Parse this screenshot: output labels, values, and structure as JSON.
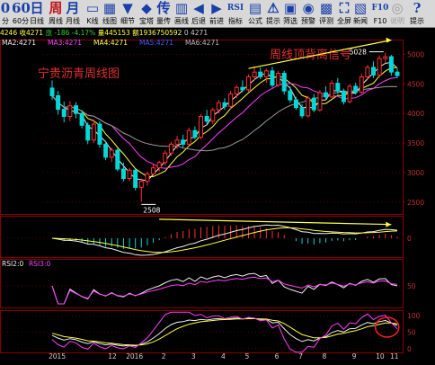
{
  "toolbar": {
    "items": [
      {
        "glyph": "0",
        "label": "分",
        "color": "blue"
      },
      {
        "glyph": "60",
        "label": "60分",
        "color": "blue"
      },
      {
        "glyph": "日",
        "label": "日线",
        "color": "blue"
      },
      {
        "glyph": "周",
        "label": "周线",
        "color": "red"
      },
      {
        "glyph": "月",
        "label": "月线",
        "color": "blue"
      },
      {
        "glyph": "▭",
        "label": "K线",
        "color": "blue"
      },
      {
        "glyph": "▦",
        "label": "线图",
        "color": "blue"
      },
      {
        "glyph": "▼",
        "label": "细节",
        "color": "blue"
      },
      {
        "glyph": "◆",
        "label": "宝塔",
        "color": "blue"
      },
      {
        "glyph": "传",
        "label": "量传",
        "color": "blue"
      },
      {
        "glyph": "▥",
        "label": "画线",
        "color": "blue"
      },
      {
        "glyph": "◀",
        "label": "后退",
        "color": "blue"
      },
      {
        "glyph": "▶",
        "label": "前进",
        "color": "blue"
      },
      {
        "glyph": "RSI",
        "label": "指标",
        "color": "blue"
      },
      {
        "glyph": "▤",
        "label": "公式",
        "color": "blue"
      },
      {
        "glyph": "⚠",
        "label": "提示",
        "color": "blue"
      },
      {
        "glyph": "▣",
        "label": "筛选",
        "color": "blue"
      },
      {
        "glyph": "◉",
        "label": "预警",
        "color": "blue"
      },
      {
        "glyph": "▩",
        "label": "评测",
        "color": "blue"
      },
      {
        "glyph": "⛶",
        "label": "全屏",
        "color": "blue"
      },
      {
        "glyph": "▧",
        "label": "新闻",
        "color": "blue"
      },
      {
        "glyph": "F10",
        "label": "F10",
        "color": "blue"
      },
      {
        "glyph": "◎",
        "label": "说明",
        "color": "dim"
      },
      {
        "glyph": "?",
        "label": "提示",
        "color": "blue"
      }
    ]
  },
  "infobar": {
    "a": "4246",
    "b": "收4271",
    "c": "涨 -186",
    "d": "-4.17%",
    "e": "量445153",
    "f": "额1936750592",
    "g": "0",
    "h": "4271"
  },
  "chart_data": {
    "type": "candlestick",
    "annotations": {
      "stock_name": "宁贵沥青周线图",
      "signal_label": "周线顶背离信号",
      "high_label": "5028",
      "low_label": "2508"
    },
    "ma_legend": [
      {
        "text": "MA2:4271",
        "color": "#f0f0f0"
      },
      {
        "text": "MA3:4271",
        "color": "#ff40ff"
      },
      {
        "text": "MA4:4271",
        "color": "#ffff40"
      },
      {
        "text": "MA5:4271",
        "color": "#4060ff"
      },
      {
        "text": "MA6:4271",
        "color": "#bbbbbb"
      }
    ],
    "rsi_legend": [
      {
        "text": "RSI2:0",
        "color": "#f0f0f0"
      },
      {
        "text": "RSI3:0",
        "color": "#ff40ff"
      }
    ],
    "y_ticks": [
      5000,
      4500,
      4000,
      3500,
      3000,
      2500
    ],
    "ylim": [
      2300,
      5250
    ],
    "macd_ticks": [
      0
    ],
    "rsi_ticks": [
      50
    ],
    "kdj_ticks": [
      100,
      50,
      0
    ],
    "x_ticks": [
      "2015",
      "12",
      "2016",
      "2",
      "3",
      "4",
      "5",
      "6",
      "7",
      "8",
      "9",
      "10",
      "11"
    ],
    "candles": [
      {
        "o": 4430,
        "h": 4560,
        "l": 4230,
        "c": 4300
      },
      {
        "o": 4300,
        "h": 4380,
        "l": 3980,
        "c": 4070
      },
      {
        "o": 4070,
        "h": 4200,
        "l": 3850,
        "c": 3950
      },
      {
        "o": 3950,
        "h": 4210,
        "l": 3870,
        "c": 4130
      },
      {
        "o": 4130,
        "h": 4190,
        "l": 3920,
        "c": 4000
      },
      {
        "o": 4000,
        "h": 4060,
        "l": 3750,
        "c": 3800
      },
      {
        "o": 3800,
        "h": 3850,
        "l": 3480,
        "c": 3550
      },
      {
        "o": 3550,
        "h": 3900,
        "l": 3500,
        "c": 3820
      },
      {
        "o": 3820,
        "h": 3870,
        "l": 3420,
        "c": 3480
      },
      {
        "o": 3480,
        "h": 3540,
        "l": 3210,
        "c": 3260
      },
      {
        "o": 3260,
        "h": 3420,
        "l": 3180,
        "c": 3380
      },
      {
        "o": 3380,
        "h": 3410,
        "l": 3020,
        "c": 3060
      },
      {
        "o": 3060,
        "h": 3170,
        "l": 2850,
        "c": 2900
      },
      {
        "o": 2900,
        "h": 3080,
        "l": 2850,
        "c": 3040
      },
      {
        "o": 3040,
        "h": 3060,
        "l": 2700,
        "c": 2750
      },
      {
        "o": 2750,
        "h": 2900,
        "l": 2508,
        "c": 2850
      },
      {
        "o": 2850,
        "h": 3020,
        "l": 2780,
        "c": 2980
      },
      {
        "o": 2980,
        "h": 3150,
        "l": 2940,
        "c": 3080
      },
      {
        "o": 3080,
        "h": 3200,
        "l": 3020,
        "c": 3170
      },
      {
        "o": 3170,
        "h": 3380,
        "l": 3120,
        "c": 3330
      },
      {
        "o": 3330,
        "h": 3520,
        "l": 3280,
        "c": 3480
      },
      {
        "o": 3480,
        "h": 3620,
        "l": 3400,
        "c": 3550
      },
      {
        "o": 3550,
        "h": 3640,
        "l": 3420,
        "c": 3480
      },
      {
        "o": 3480,
        "h": 3760,
        "l": 3450,
        "c": 3710
      },
      {
        "o": 3710,
        "h": 3780,
        "l": 3560,
        "c": 3600
      },
      {
        "o": 3600,
        "h": 3990,
        "l": 3560,
        "c": 3950
      },
      {
        "o": 3950,
        "h": 4060,
        "l": 3820,
        "c": 3870
      },
      {
        "o": 3870,
        "h": 4100,
        "l": 3820,
        "c": 4060
      },
      {
        "o": 4060,
        "h": 4230,
        "l": 4000,
        "c": 4180
      },
      {
        "o": 4180,
        "h": 4260,
        "l": 4060,
        "c": 4120
      },
      {
        "o": 4120,
        "h": 4380,
        "l": 4080,
        "c": 4330
      },
      {
        "o": 4330,
        "h": 4480,
        "l": 4260,
        "c": 4440
      },
      {
        "o": 4440,
        "h": 4560,
        "l": 4360,
        "c": 4400
      },
      {
        "o": 4400,
        "h": 4660,
        "l": 4370,
        "c": 4620
      },
      {
        "o": 4620,
        "h": 4800,
        "l": 4560,
        "c": 4700
      },
      {
        "o": 4700,
        "h": 4780,
        "l": 4580,
        "c": 4620
      },
      {
        "o": 4620,
        "h": 4760,
        "l": 4520,
        "c": 4720
      },
      {
        "o": 4720,
        "h": 4790,
        "l": 4440,
        "c": 4480
      },
      {
        "o": 4480,
        "h": 4720,
        "l": 4450,
        "c": 4680
      },
      {
        "o": 4680,
        "h": 4720,
        "l": 4320,
        "c": 4380
      },
      {
        "o": 4380,
        "h": 4460,
        "l": 4180,
        "c": 4230
      },
      {
        "o": 4230,
        "h": 4280,
        "l": 4060,
        "c": 4100
      },
      {
        "o": 4100,
        "h": 4160,
        "l": 3920,
        "c": 3960
      },
      {
        "o": 3960,
        "h": 4300,
        "l": 3930,
        "c": 4260
      },
      {
        "o": 4260,
        "h": 4330,
        "l": 4020,
        "c": 4060
      },
      {
        "o": 4060,
        "h": 4400,
        "l": 4030,
        "c": 4350
      },
      {
        "o": 4350,
        "h": 4460,
        "l": 4240,
        "c": 4280
      },
      {
        "o": 4280,
        "h": 4560,
        "l": 4260,
        "c": 4510
      },
      {
        "o": 4510,
        "h": 4600,
        "l": 4330,
        "c": 4380
      },
      {
        "o": 4380,
        "h": 4420,
        "l": 4150,
        "c": 4200
      },
      {
        "o": 4200,
        "h": 4500,
        "l": 4170,
        "c": 4460
      },
      {
        "o": 4460,
        "h": 4520,
        "l": 4320,
        "c": 4360
      },
      {
        "o": 4360,
        "h": 4680,
        "l": 4330,
        "c": 4620
      },
      {
        "o": 4620,
        "h": 4820,
        "l": 4560,
        "c": 4780
      },
      {
        "o": 4780,
        "h": 4880,
        "l": 4600,
        "c": 4650
      },
      {
        "o": 4650,
        "h": 4980,
        "l": 4620,
        "c": 4930
      },
      {
        "o": 4930,
        "h": 5028,
        "l": 4850,
        "c": 4960
      },
      {
        "o": 4960,
        "h": 4990,
        "l": 4640,
        "c": 4700
      },
      {
        "o": 4700,
        "h": 4760,
        "l": 4600,
        "c": 4640
      }
    ]
  }
}
